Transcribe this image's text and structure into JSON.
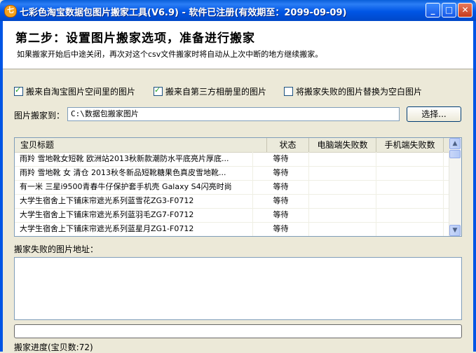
{
  "window": {
    "title": "七彩色淘宝数据包图片搬家工具(V6.9) - 软件已注册(有效期至：2099-09-09)",
    "icon_text": "七"
  },
  "header": {
    "title": "第二步：设置图片搬家选项，准备进行搬家",
    "subtitle": "如果搬家开始后中途关闭，再次对这个csv文件搬家时将自动从上次中断的地方继续搬家。"
  },
  "options": {
    "opt1": {
      "label": "搬来自淘宝图片空间里的图片",
      "checked": true
    },
    "opt2": {
      "label": "搬来自第三方相册里的图片",
      "checked": true
    },
    "opt3": {
      "label": "将搬家失败的图片替换为空白图片",
      "checked": false
    }
  },
  "dest": {
    "label": "图片搬家到：",
    "path": "C:\\数据包搬家图片",
    "browse_label": "选择..."
  },
  "table": {
    "columns": [
      "宝贝标题",
      "状态",
      "电脑端失败数",
      "手机端失败数"
    ],
    "rows": [
      {
        "title": "雨羚 雪地靴女短靴 欧洲站2013秋新款潮防水平底亮片厚底...",
        "status": "等待",
        "pc_fail": "",
        "mobile_fail": ""
      },
      {
        "title": "雨羚 雪地靴 女 清仓 2013秋冬新品短靴糖果色真皮雪地靴...",
        "status": "等待",
        "pc_fail": "",
        "mobile_fail": ""
      },
      {
        "title": "有一米 三星i9500青春牛仔保护套手机壳 Galaxy S4闪亮时尚",
        "status": "等待",
        "pc_fail": "",
        "mobile_fail": ""
      },
      {
        "title": "大学生宿舍上下铺床帘遮光系列蓝雪花ZG3-F0712",
        "status": "等待",
        "pc_fail": "",
        "mobile_fail": ""
      },
      {
        "title": "大学生宿舍上下铺床帘遮光系列蓝羽毛ZG7-F0712",
        "status": "等待",
        "pc_fail": "",
        "mobile_fail": ""
      },
      {
        "title": "大学生宿舍上下铺床帘遮光系列蓝星月ZG1-F0712",
        "status": "等待",
        "pc_fail": "",
        "mobile_fail": ""
      }
    ]
  },
  "fail_section": {
    "label": "搬家失败的图片地址：",
    "content": ""
  },
  "progress": {
    "value": 0,
    "label": "搬家进度(宝贝数:72)"
  },
  "icons": {
    "minimize": "minimize-icon",
    "maximize": "maximize-icon",
    "close": "close-icon",
    "scroll_up": "scroll-up-icon",
    "scroll_down": "scroll-down-icon"
  },
  "colors": {
    "titlebar": "#0055e5",
    "window_bg": "#ece9d8",
    "check_mark": "#21a121"
  }
}
